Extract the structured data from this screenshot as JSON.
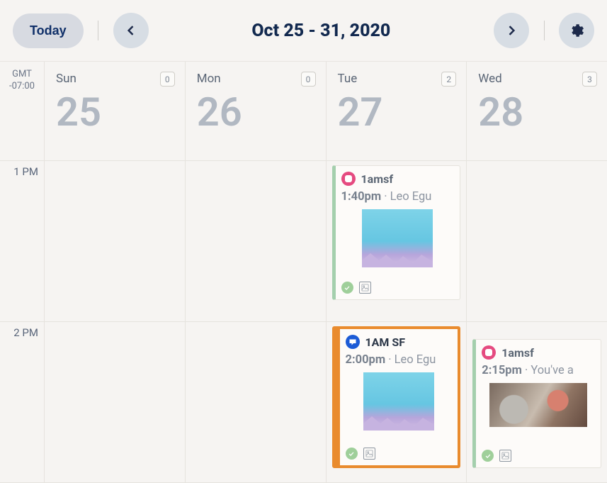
{
  "toolbar": {
    "today_label": "Today",
    "date_range": "Oct 25 - 31, 2020"
  },
  "timezone": {
    "label": "GMT",
    "offset": "-07:00"
  },
  "days": [
    {
      "name": "Sun",
      "num": "25",
      "count": "0"
    },
    {
      "name": "Mon",
      "num": "26",
      "count": "0"
    },
    {
      "name": "Tue",
      "num": "27",
      "count": "2"
    },
    {
      "name": "Wed",
      "num": "28",
      "count": "3"
    }
  ],
  "hours": [
    "1 PM",
    "2 PM"
  ],
  "events": {
    "tue_1pm": {
      "network": "instagram",
      "account": "1amsf",
      "time": "1:40pm",
      "text": "Leo Egu"
    },
    "tue_2pm": {
      "network": "facebook",
      "account": "1AM SF",
      "time": "2:00pm",
      "text": "Leo Egu"
    },
    "wed_2pm": {
      "network": "instagram",
      "account": "1amsf",
      "time": "2:15pm",
      "text": "You've a"
    }
  }
}
